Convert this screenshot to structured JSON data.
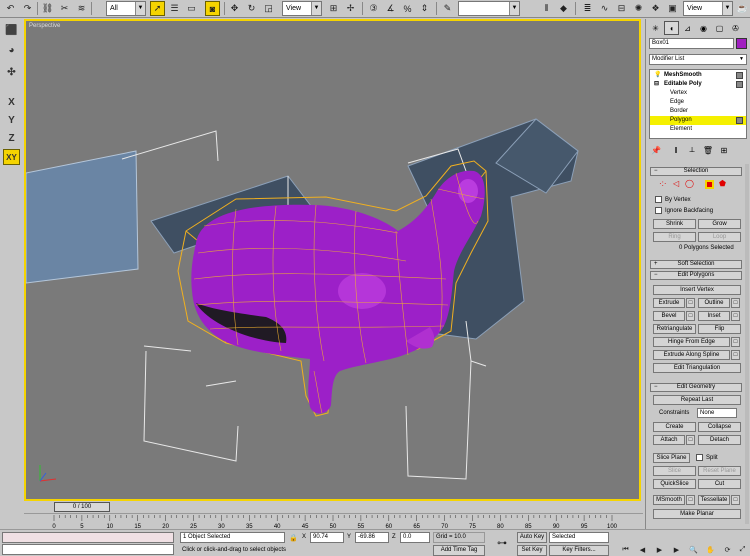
{
  "toolbar": {
    "selection_filter": "All",
    "ref_coord": "View",
    "named_sel": "View"
  },
  "left_toolbar": {
    "axes": [
      "X",
      "Y",
      "Z",
      "XY"
    ]
  },
  "viewport": {
    "label": "Perspective",
    "colors": {
      "background": "#7a7a7a",
      "mesh": "#9c20c8",
      "cage": "#f0b020",
      "border": "#f5d400"
    }
  },
  "time_slider": {
    "position": "0 / 100",
    "ticks": [
      "0",
      "5",
      "10",
      "15",
      "20",
      "25",
      "30",
      "35",
      "40",
      "45",
      "50",
      "55",
      "60",
      "65",
      "70",
      "75",
      "80",
      "85",
      "90",
      "95",
      "100"
    ]
  },
  "status": {
    "selected": "1 Object Selected",
    "prompt": "Click or click-and-drag to select objects",
    "x_label": "X",
    "x_value": "90.74",
    "y_label": "Y",
    "y_value": "-69.86",
    "z_label": "Z",
    "z_value": "0.0",
    "grid": "Grid = 10.0",
    "add_time_tag": "Add Time Tag",
    "auto_key": "Auto Key",
    "set_key": "Set Key",
    "selected_dropdown": "Selected",
    "key_filters": "Key Filters..."
  },
  "command_panel": {
    "object_name": "Box01",
    "object_color": "#a020c0",
    "modifier_list": "Modifier List",
    "stack": [
      {
        "label": "MeshSmooth",
        "bold": true
      },
      {
        "label": "Editable Poly",
        "bold": true
      },
      {
        "label": "Vertex"
      },
      {
        "label": "Edge"
      },
      {
        "label": "Border"
      },
      {
        "label": "Polygon",
        "selected": true
      },
      {
        "label": "Element"
      }
    ],
    "selection": {
      "title": "Selection",
      "by_vertex": "By Vertex",
      "ignore_backfacing": "Ignore Backfacing",
      "shrink": "Shrink",
      "grow": "Grow",
      "ring": "Ring",
      "loop": "Loop",
      "info": "0 Polygons Selected"
    },
    "soft_selection": {
      "title": "Soft Selection"
    },
    "edit_polygons": {
      "title": "Edit Polygons",
      "insert_vertex": "Insert Vertex",
      "extrude": "Extrude",
      "outline": "Outline",
      "bevel": "Bevel",
      "inset": "Inset",
      "retriangulate": "Retriangulate",
      "flip": "Flip",
      "hinge_from_edge": "Hinge From Edge",
      "extrude_along_spline": "Extrude Along Spline",
      "edit_triangulation": "Edit Triangulation"
    },
    "edit_geometry": {
      "title": "Edit Geometry",
      "repeat_last": "Repeat Last",
      "constraints_label": "Constraints",
      "constraints_value": "None",
      "create": "Create",
      "collapse": "Collapse",
      "attach": "Attach",
      "detach": "Detach",
      "slice_plane": "Slice Plane",
      "split": "Split",
      "slice": "Slice",
      "reset_plane": "Reset Plane",
      "quickslice": "QuickSlice",
      "cut": "Cut",
      "msmooth": "MSmooth",
      "tessellate": "Tessellate",
      "make_planar": "Make Planar"
    }
  }
}
